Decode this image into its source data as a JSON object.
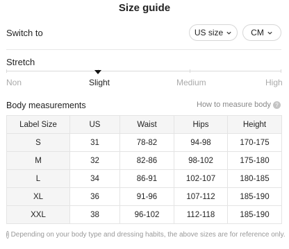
{
  "title": "Size guide",
  "switch": {
    "label": "Switch to",
    "size_system": "US size",
    "unit": "CM"
  },
  "stretch": {
    "title": "Stretch",
    "levels": [
      "Non",
      "Slight",
      "Medium",
      "High"
    ],
    "selected": "Slight"
  },
  "body_measurements": {
    "title": "Body measurements",
    "how_to_link": "How to measure body",
    "headers": [
      "Label Size",
      "US",
      "Waist",
      "Hips",
      "Height"
    ],
    "rows": [
      [
        "S",
        "31",
        "78-82",
        "94-98",
        "170-175"
      ],
      [
        "M",
        "32",
        "82-86",
        "98-102",
        "175-180"
      ],
      [
        "L",
        "34",
        "86-91",
        "102-107",
        "180-185"
      ],
      [
        "XL",
        "36",
        "91-96",
        "107-112",
        "185-190"
      ],
      [
        "XXL",
        "38",
        "96-102",
        "112-118",
        "185-190"
      ]
    ]
  },
  "footnote": "Depending on your body type and dressing habits, the above sizes are for reference only."
}
